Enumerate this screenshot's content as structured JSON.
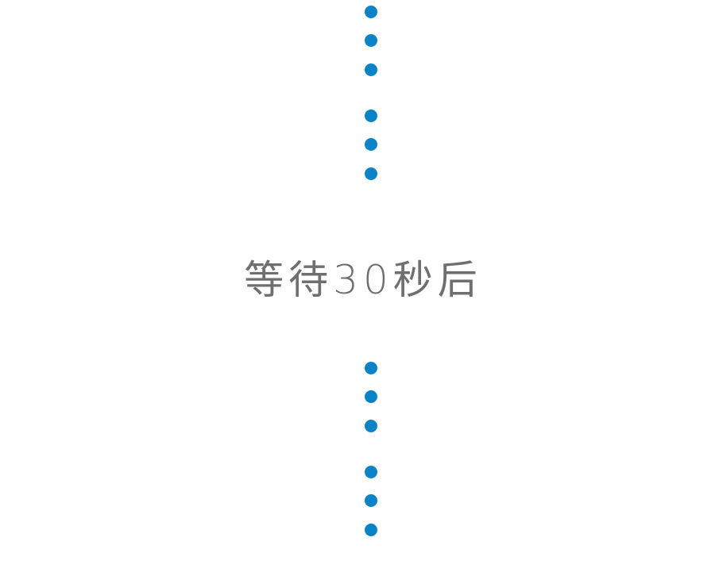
{
  "caption": {
    "text": "等待30秒后"
  },
  "colors": {
    "dot": "#0a84c6",
    "caption": "#6f6f70",
    "background": "#ffffff"
  },
  "decor": {
    "top_dots_icon": "dotted-separator-icon",
    "bottom_dots_icon": "dotted-separator-icon"
  }
}
